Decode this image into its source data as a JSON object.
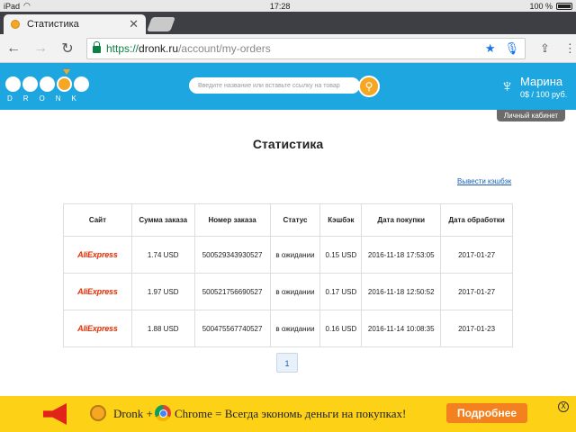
{
  "statusbar": {
    "device": "iPad",
    "time": "17:28",
    "battery": "100 %"
  },
  "browser": {
    "tab_title": "Статистика",
    "url_scheme": "https://",
    "url_host": "dronk.ru",
    "url_path": "/account/my-orders"
  },
  "header": {
    "logo_text": "DRONK",
    "search_placeholder": "Введите название или вставьте ссылку на товар",
    "user_name": "Марина",
    "user_balance": "0$ / 100 руб.",
    "cabinet_label": "Личный кабинет"
  },
  "main": {
    "title": "Статистика",
    "cashback_link": "Вывести кэшбэк",
    "columns": [
      "Сайт",
      "Сумма заказа",
      "Номер заказа",
      "Статус",
      "Кэшбэк",
      "Дата покупки",
      "Дата обработки"
    ],
    "rows": [
      {
        "site_a": "Ali",
        "site_b": "Express",
        "sum": "1.74 USD",
        "order": "500529343930527",
        "status": "в ожидании",
        "cashback": "0.15 USD",
        "bought": "2016-11-18 17:53:05",
        "processed": "2017-01-27"
      },
      {
        "site_a": "Ali",
        "site_b": "Express",
        "sum": "1.97 USD",
        "order": "500521756690527",
        "status": "в ожидании",
        "cashback": "0.17 USD",
        "bought": "2016-11-18 12:50:52",
        "processed": "2017-01-27"
      },
      {
        "site_a": "Ali",
        "site_b": "Express",
        "sum": "1.88 USD",
        "order": "500475567740527",
        "status": "в ожидании",
        "cashback": "0.16 USD",
        "bought": "2016-11-14 10:08:35",
        "processed": "2017-01-23"
      }
    ],
    "page": "1"
  },
  "banner": {
    "text1": "Dronk +",
    "text2": "Chrome = Всегда экономь деньги на покупках!",
    "button": "Подробнее",
    "close": "X"
  },
  "colors": {
    "header": "#1ea6e0",
    "accent": "#f5a623",
    "banner": "#fcd116",
    "link": "#1a5fb4"
  }
}
